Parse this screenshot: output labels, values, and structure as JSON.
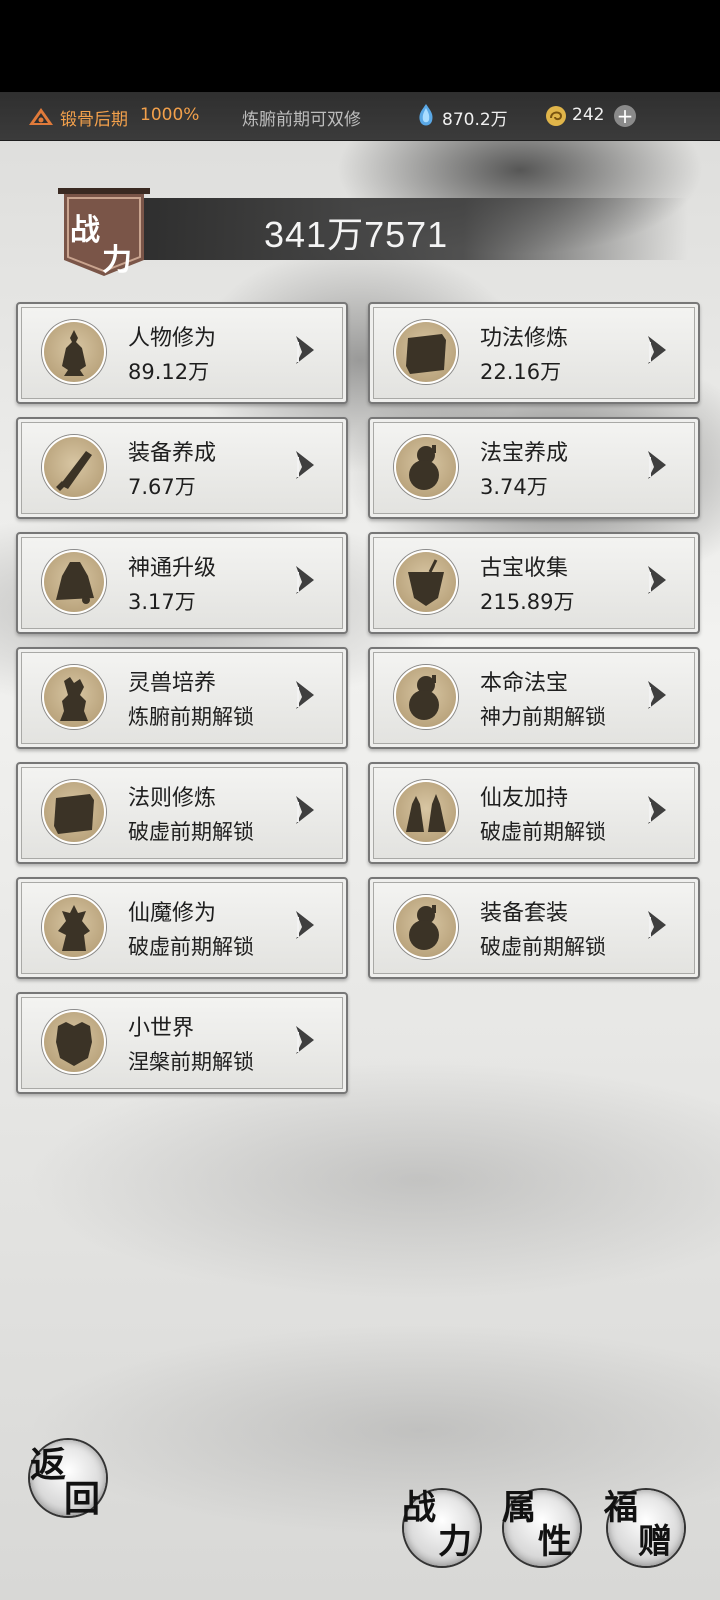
{
  "topbar": {
    "realm_label": "锻骨后期",
    "realm_percent": "1000%",
    "hint": "炼腑前期可双修",
    "spirit_stones": "870.2万",
    "coins": "242",
    "plus_symbol": "+"
  },
  "power": {
    "flag_chars": [
      "战",
      "力"
    ],
    "value": "341万7571"
  },
  "cards": [
    {
      "title": "人物修为",
      "sub": "89.12万",
      "icon": "warrior-silhouette-icon"
    },
    {
      "title": "功法修炼",
      "sub": "22.16万",
      "icon": "scroll-icon"
    },
    {
      "title": "装备养成",
      "sub": "7.67万",
      "icon": "sword-icon"
    },
    {
      "title": "法宝养成",
      "sub": "3.74万",
      "icon": "gourd-icon"
    },
    {
      "title": "神通升级",
      "sub": "3.17万",
      "icon": "bell-icon"
    },
    {
      "title": "古宝收集",
      "sub": "215.89万",
      "icon": "treasure-icon"
    },
    {
      "title": "灵兽培养",
      "sub": "炼腑前期解锁",
      "icon": "beast-icon"
    },
    {
      "title": "本命法宝",
      "sub": "神力前期解锁",
      "icon": "gourd-icon"
    },
    {
      "title": "法则修炼",
      "sub": "破虚前期解锁",
      "icon": "scroll-icon"
    },
    {
      "title": "仙友加持",
      "sub": "破虚前期解锁",
      "icon": "companions-icon"
    },
    {
      "title": "仙魔修为",
      "sub": "破虚前期解锁",
      "icon": "demon-silhouette-icon"
    },
    {
      "title": "装备套装",
      "sub": "破虚前期解锁",
      "icon": "gourd-icon"
    },
    {
      "title": "小世界",
      "sub": "涅槃前期解锁",
      "icon": "world-icon"
    }
  ],
  "bottom": {
    "back": [
      "返",
      "回"
    ],
    "tab_power": [
      "战",
      "力"
    ],
    "tab_attr": [
      "属",
      "性"
    ],
    "tab_gift": [
      "福",
      "赠"
    ]
  },
  "colors": {
    "realm_orange": "#f2a04b",
    "topbar_bg": "#333333",
    "card_bg": "#eeeeec",
    "emblem_gold": "#b9a37c"
  }
}
